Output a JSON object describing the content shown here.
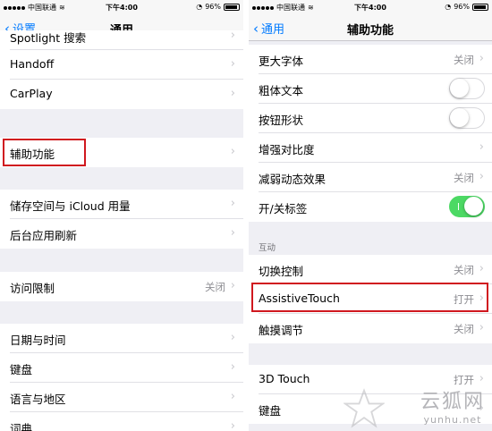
{
  "status_bar": {
    "carrier": "中国联通",
    "time": "下午4:00",
    "battery": "96%"
  },
  "left_screen": {
    "back_label": "设置",
    "title": "通用",
    "rows": [
      {
        "label": "Spotlight 搜索"
      },
      {
        "label": "Handoff"
      },
      {
        "label": "CarPlay"
      },
      {
        "label": "辅助功能"
      },
      {
        "label": "储存空间与 iCloud 用量"
      },
      {
        "label": "后台应用刷新"
      },
      {
        "label": "访问限制",
        "value": "关闭"
      },
      {
        "label": "日期与时间"
      },
      {
        "label": "键盘"
      },
      {
        "label": "语言与地区"
      },
      {
        "label": "词典"
      }
    ]
  },
  "right_screen": {
    "back_label": "通用",
    "title": "辅助功能",
    "rows": [
      {
        "label": "更大字体",
        "value": "关闭"
      },
      {
        "label": "粗体文本",
        "toggle": false
      },
      {
        "label": "按钮形状",
        "toggle": false
      },
      {
        "label": "增强对比度"
      },
      {
        "label": "减弱动态效果",
        "value": "关闭"
      },
      {
        "label": "开/关标签",
        "toggle": true
      },
      {
        "label": "切换控制",
        "value": "关闭"
      },
      {
        "label": "AssistiveTouch",
        "value": "打开"
      },
      {
        "label": "触摸调节",
        "value": "关闭"
      },
      {
        "label": "3D Touch",
        "value": "打开"
      },
      {
        "label": "键盘"
      }
    ],
    "section_label": "互动"
  },
  "watermark": {
    "text": "云狐网",
    "url": "yunhu.net"
  },
  "colors": {
    "ios_blue": "#007aff",
    "switch_on": "#4cd964",
    "highlight_red": "#d0181f",
    "group_bg": "#efeff4"
  }
}
